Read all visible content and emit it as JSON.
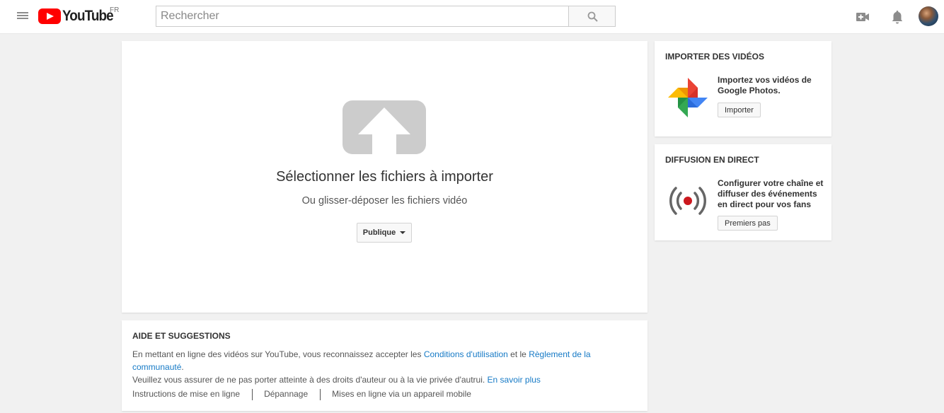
{
  "header": {
    "logo_text": "YouTube",
    "country_code": "FR",
    "search_placeholder": "Rechercher"
  },
  "upload": {
    "title": "Sélectionner les fichiers à importer",
    "subtitle": "Ou glisser-déposer les fichiers vidéo",
    "privacy_label": "Publique"
  },
  "import_videos": {
    "title": "IMPORTER DES VIDÉOS",
    "text": "Importez vos vidéos de Google Photos.",
    "button": "Importer"
  },
  "live": {
    "title": "DIFFUSION EN DIRECT",
    "text": "Configurer votre chaîne et diffuser des événements en direct pour vos fans",
    "button": "Premiers pas"
  },
  "help": {
    "title": "AIDE ET SUGGESTIONS",
    "line1_prefix": "En mettant en ligne des vidéos sur YouTube, vous reconnaissez accepter les ",
    "line1_link1": "Conditions d'utilisation",
    "line1_mid": " et le ",
    "line1_link2": "Règlement de la communauté",
    "line1_suffix": ".",
    "line2_prefix": "Veuillez vous assurer de ne pas porter atteinte à des droits d'auteur ou à la vie privée d'autrui. ",
    "line2_link": "En savoir plus",
    "footer_links": [
      "Instructions de mise en ligne",
      "Dépannage",
      "Mises en ligne via un appareil mobile"
    ]
  },
  "colors": {
    "youtube_red": "#ff0000",
    "link_blue": "#167ac6",
    "background": "#f1f1f1",
    "live_dot": "#cc181e"
  }
}
